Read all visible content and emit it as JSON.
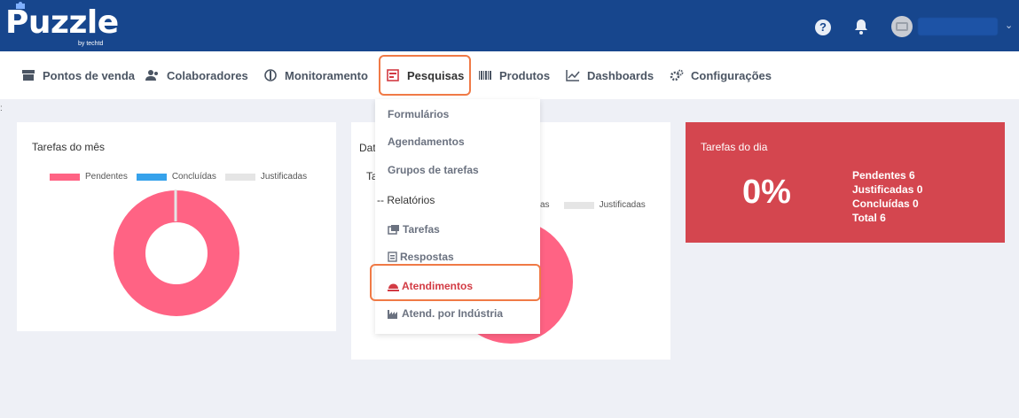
{
  "header": {
    "logo_text": "Puzzle",
    "logo_sub": "by techtd",
    "help_label": "?",
    "user_caret": "⌄"
  },
  "nav": {
    "items": [
      {
        "label": "Pontos de venda",
        "icon": "store-icon"
      },
      {
        "label": "Colaboradores",
        "icon": "users-icon"
      },
      {
        "label": "Monitoramento",
        "icon": "monitor-icon"
      },
      {
        "label": "Pesquisas",
        "icon": "survey-icon"
      },
      {
        "label": "Produtos",
        "icon": "barcode-icon"
      },
      {
        "label": "Dashboards",
        "icon": "chart-line-icon"
      },
      {
        "label": "Configurações",
        "icon": "gears-icon"
      }
    ]
  },
  "dropdown": {
    "items": [
      {
        "label": "Formulários"
      },
      {
        "label": "Agendamentos"
      },
      {
        "label": "Grupos de tarefas"
      },
      {
        "label": "-- Relatórios"
      },
      {
        "label": "Tarefas",
        "icon": "tasks-icon"
      },
      {
        "label": "Respostas",
        "icon": "answers-icon"
      },
      {
        "label": "Atendimentos",
        "icon": "service-bell-icon"
      },
      {
        "label": "Atend. por Indústria",
        "icon": "industry-icon"
      }
    ]
  },
  "card_month": {
    "title": "Tarefas do mês",
    "legend": [
      "Pendentes",
      "Concluídas",
      "Justificadas"
    ]
  },
  "card_date": {
    "title_partial": "Dat",
    "subtitle_partial": "Ta",
    "legend_partial": [
      "as",
      "Justificadas"
    ]
  },
  "card_day": {
    "title": "Tarefas do dia",
    "percent": "0%",
    "stats": [
      "Pendentes 6",
      "Justificadas 0",
      "Concluídas 0",
      "Total 6"
    ]
  },
  "colors": {
    "header_bg": "#17468d",
    "pendentes": "#ff6384",
    "concluidas": "#36a2eb",
    "justificadas": "#e5e5e5",
    "red_card": "#d4464f",
    "highlight": "#f07a46"
  }
}
